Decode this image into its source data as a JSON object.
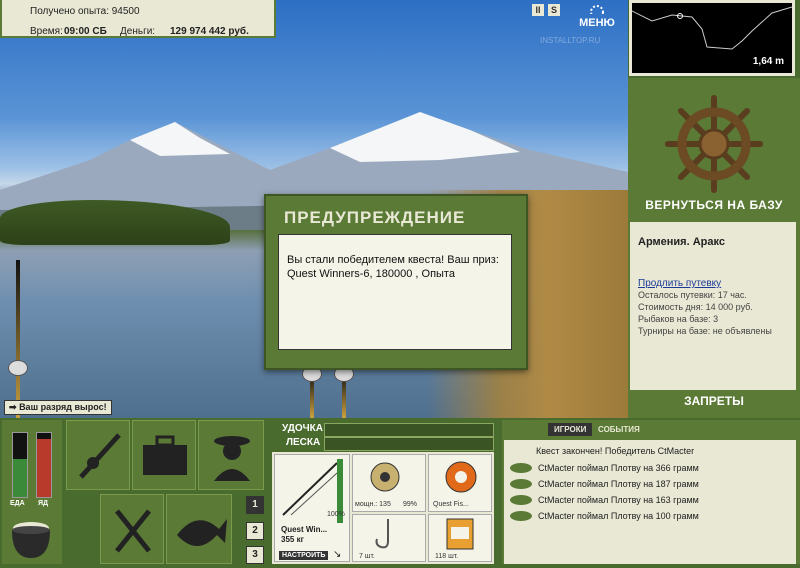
{
  "stats": {
    "experience_label": "Получено опыта: 94500",
    "time_label": "Время:",
    "time_value": "09:00 СБ",
    "money_label": "Деньги:",
    "money_value": "129 974 442 руб."
  },
  "top_icons": {
    "pause": "II",
    "sound": "S"
  },
  "menu_label": "МЕНЮ",
  "watermark": "INSTALLTOP.RU",
  "depth": {
    "value_label": "1,64 m"
  },
  "return_to_base": "ВЕРНУТЬСЯ НА БАЗУ",
  "location": {
    "title": "Армения. Аракс",
    "extend_link": "Продлить путевку",
    "lines": [
      "Осталось путевки: 17 час.",
      "Стоимость дня: 14 000 руб.",
      "Рыбаков на базе: 3",
      "Турниры на базе: не объявлены"
    ]
  },
  "bans_label": "ЗАПРЕТЫ",
  "promo": "Ваш разряд вырос!",
  "dialog": {
    "title": "ПРЕДУПРЕЖДЕНИЕ",
    "body": "Вы стали победителем квеста! Ваш приз: Quest Winners-6, 180000 , Опыта"
  },
  "meters": {
    "food_label": "ЕДА",
    "poison_label": "ЯД",
    "food_level": 0.6,
    "poison_level": 0.9
  },
  "tabs": [
    "1",
    "2",
    "3"
  ],
  "equipment": {
    "rod_label": "УДОЧКА",
    "line_label": "ЛЕСКА",
    "rod_name": "Quest Win...",
    "rod_weight": "355 кг",
    "rod_percent": "100%",
    "reel_power": "мощн.: 135",
    "reel_percent": "99%",
    "line_name": "Quest Fis...",
    "hook_count": "7 шт.",
    "bait_count": "118 шт.",
    "tune_button": "НАСТРОИТЬ"
  },
  "events": {
    "tab_players": "ИГРОКИ",
    "tab_events": "СОБЫТИЯ",
    "header": "Квест закончен! Победитель CtMacter",
    "rows": [
      "CtMacter поймал Плотву на 366 грамм",
      "CtMacter поймал Плотву на 187 грамм",
      "CtMacter поймал Плотву на 163 грамм",
      "CtMacter поймал Плотву на 100 грамм"
    ]
  }
}
